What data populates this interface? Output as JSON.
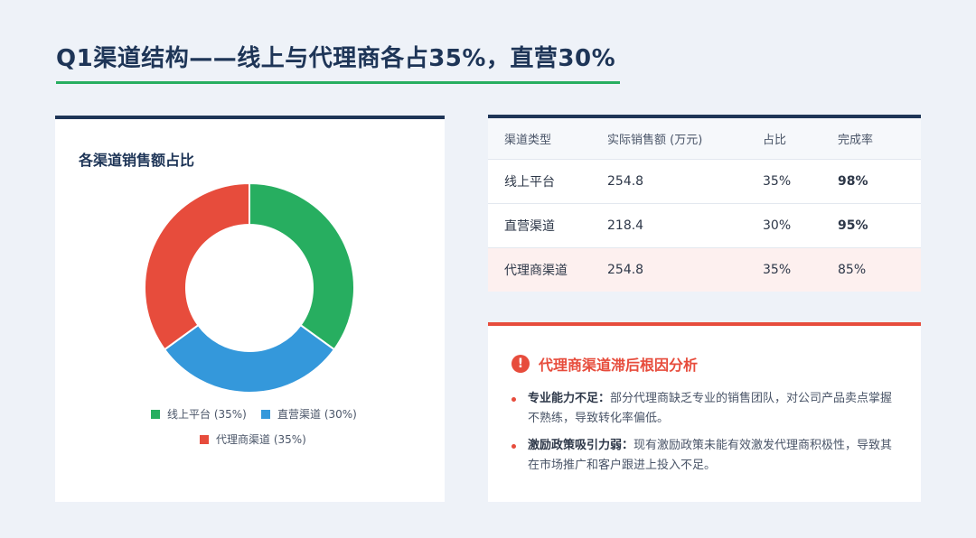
{
  "page": {
    "title": "Q1渠道结构——线上与代理商各占35%，直营30%"
  },
  "colors": {
    "navy": "#1e3557",
    "green": "#27ae60",
    "blue": "#3498db",
    "red": "#e74c3c"
  },
  "chart_data": {
    "type": "pie",
    "title": "各渠道销售额占比",
    "donut": true,
    "legend_position": "bottom",
    "series": [
      {
        "name": "线上平台",
        "value": 35,
        "color": "#27ae60",
        "legend_label": "线上平台 (35%)"
      },
      {
        "name": "直营渠道",
        "value": 30,
        "color": "#3498db",
        "legend_label": "直营渠道 (30%)"
      },
      {
        "name": "代理商渠道",
        "value": 35,
        "color": "#e74c3c",
        "legend_label": "代理商渠道 (35%)"
      }
    ]
  },
  "table": {
    "headers": [
      "渠道类型",
      "实际销售额 (万元)",
      "占比",
      "完成率"
    ],
    "rows": [
      {
        "type": "线上平台",
        "sales": "254.8",
        "share": "35%",
        "rate": "98%"
      },
      {
        "type": "直营渠道",
        "sales": "218.4",
        "share": "30%",
        "rate": "95%"
      },
      {
        "type": "代理商渠道",
        "sales": "254.8",
        "share": "35%",
        "rate": "85%"
      }
    ]
  },
  "analysis": {
    "icon": "alert-icon",
    "icon_glyph": "!",
    "title": "代理商渠道滞后根因分析",
    "items": [
      {
        "label": "专业能力不足：",
        "text": "部分代理商缺乏专业的销售团队，对公司产品卖点掌握不熟练，导致转化率偏低。"
      },
      {
        "label": "激励政策吸引力弱：",
        "text": "现有激励政策未能有效激发代理商积极性，导致其在市场推广和客户跟进上投入不足。"
      }
    ]
  }
}
